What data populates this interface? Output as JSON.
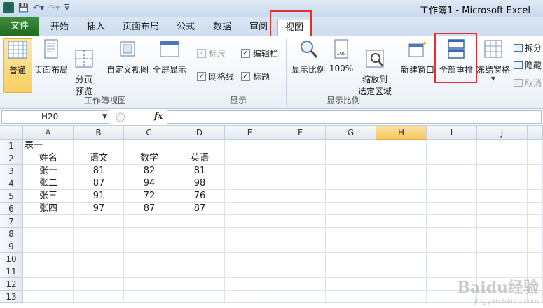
{
  "window": {
    "title": "工作簿1 - Microsoft Excel"
  },
  "tabs": [
    {
      "label": "文件"
    },
    {
      "label": "开始"
    },
    {
      "label": "插入"
    },
    {
      "label": "页面布局"
    },
    {
      "label": "公式"
    },
    {
      "label": "数据"
    },
    {
      "label": "审阅"
    },
    {
      "label": "视图",
      "active": true
    }
  ],
  "ribbon": {
    "workbook_views": {
      "normal": "普通",
      "page_layout": "页面布局",
      "page_break": "分页\n预览",
      "custom_views": "自定义视图",
      "full_screen": "全屏显示",
      "group_label": "工作簿视图"
    },
    "show": {
      "ruler": "标尺",
      "formula_bar": "编辑栏",
      "gridlines": "网格线",
      "headings": "标题",
      "group_label": "显示"
    },
    "zoom": {
      "zoom": "显示比例",
      "zoom_100": "100%",
      "zoom_selection": "缩放到\n选定区域",
      "group_label": "显示比例"
    },
    "window": {
      "new_window": "新建窗口",
      "arrange_all": "全部重排",
      "freeze_panes": "冻结窗格",
      "split": "拆分",
      "hide": "隐藏",
      "unhide": "取消"
    }
  },
  "formula_bar": {
    "name_box": "H20",
    "fx_label": "fx",
    "formula": ""
  },
  "grid": {
    "columns": [
      "A",
      "B",
      "C",
      "D",
      "E",
      "F",
      "G",
      "H",
      "I",
      "J"
    ],
    "active_column": "H",
    "rows": [
      "1",
      "2",
      "3",
      "4",
      "5",
      "6",
      "7",
      "8",
      "9",
      "10",
      "11",
      "12",
      "13"
    ],
    "cells": {
      "title": "表一",
      "headers": [
        "姓名",
        "语文",
        "数学",
        "英语"
      ],
      "data": [
        [
          "张一",
          "81",
          "82",
          "81"
        ],
        [
          "张二",
          "87",
          "94",
          "98"
        ],
        [
          "张三",
          "91",
          "72",
          "76"
        ],
        [
          "张四",
          "97",
          "87",
          "87"
        ]
      ]
    }
  },
  "watermark": {
    "main": "Baidu经验",
    "sub": "jingyan.baidu.com"
  },
  "colors": {
    "file_tab": "#2f7d32",
    "highlight_box": "#e03030",
    "selected_button": "#f7cf63"
  }
}
